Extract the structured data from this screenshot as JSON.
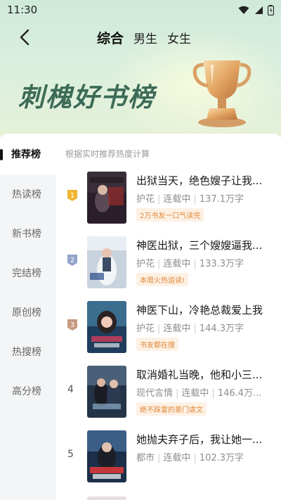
{
  "status_bar": {
    "time": "11:30"
  },
  "nav": {
    "tabs": [
      {
        "label": "综合",
        "active": true
      },
      {
        "label": "男生",
        "active": false
      },
      {
        "label": "女生",
        "active": false
      }
    ]
  },
  "banner": {
    "title": "刺槐好书榜"
  },
  "sidebar": {
    "active": "推荐榜",
    "items": [
      "热读榜",
      "新书榜",
      "完结榜",
      "原创榜",
      "热搜榜",
      "高分榜"
    ]
  },
  "list": {
    "subtitle": "根据实时推荐热度计算",
    "books": [
      {
        "rank": "1",
        "title": "出狱当天，绝色嫂子让我...",
        "genre": "护花",
        "status": "连载中",
        "words": "137.1万字",
        "tag": "2万书友一口气读完"
      },
      {
        "rank": "2",
        "title": "神医出狱，三个嫂嫂逼我...",
        "genre": "护花",
        "status": "连载中",
        "words": "133.3万字",
        "tag": "本周火热追读!"
      },
      {
        "rank": "3",
        "title": "神医下山，冷艳总裁爱上我",
        "genre": "护花",
        "status": "连载中",
        "words": "144.3万字",
        "tag": "书友都在搜"
      },
      {
        "rank": "4",
        "title": "取消婚礼当晚，他和小三...",
        "genre": "现代言情",
        "status": "连载中",
        "words": "146.4万...",
        "tag": "绝不踩雷的豪门虐文"
      },
      {
        "rank": "5",
        "title": "她抛夫弃子后，我让她一...",
        "genre": "都市",
        "status": "连载中",
        "words": "102.3万字",
        "tag": ""
      }
    ]
  },
  "colors": {
    "banner_title": "#3c6b57",
    "tag_text": "#e0873a",
    "tag_bg": "#fdf1e4",
    "rank1": "#f2b431",
    "rank2": "#93a4c9",
    "rank3": "#c79a80"
  },
  "icons": [
    "wifi-icon",
    "signal-icon",
    "battery-icon",
    "back-arrow-icon",
    "trophy-icon",
    "rank-badge-icon"
  ]
}
